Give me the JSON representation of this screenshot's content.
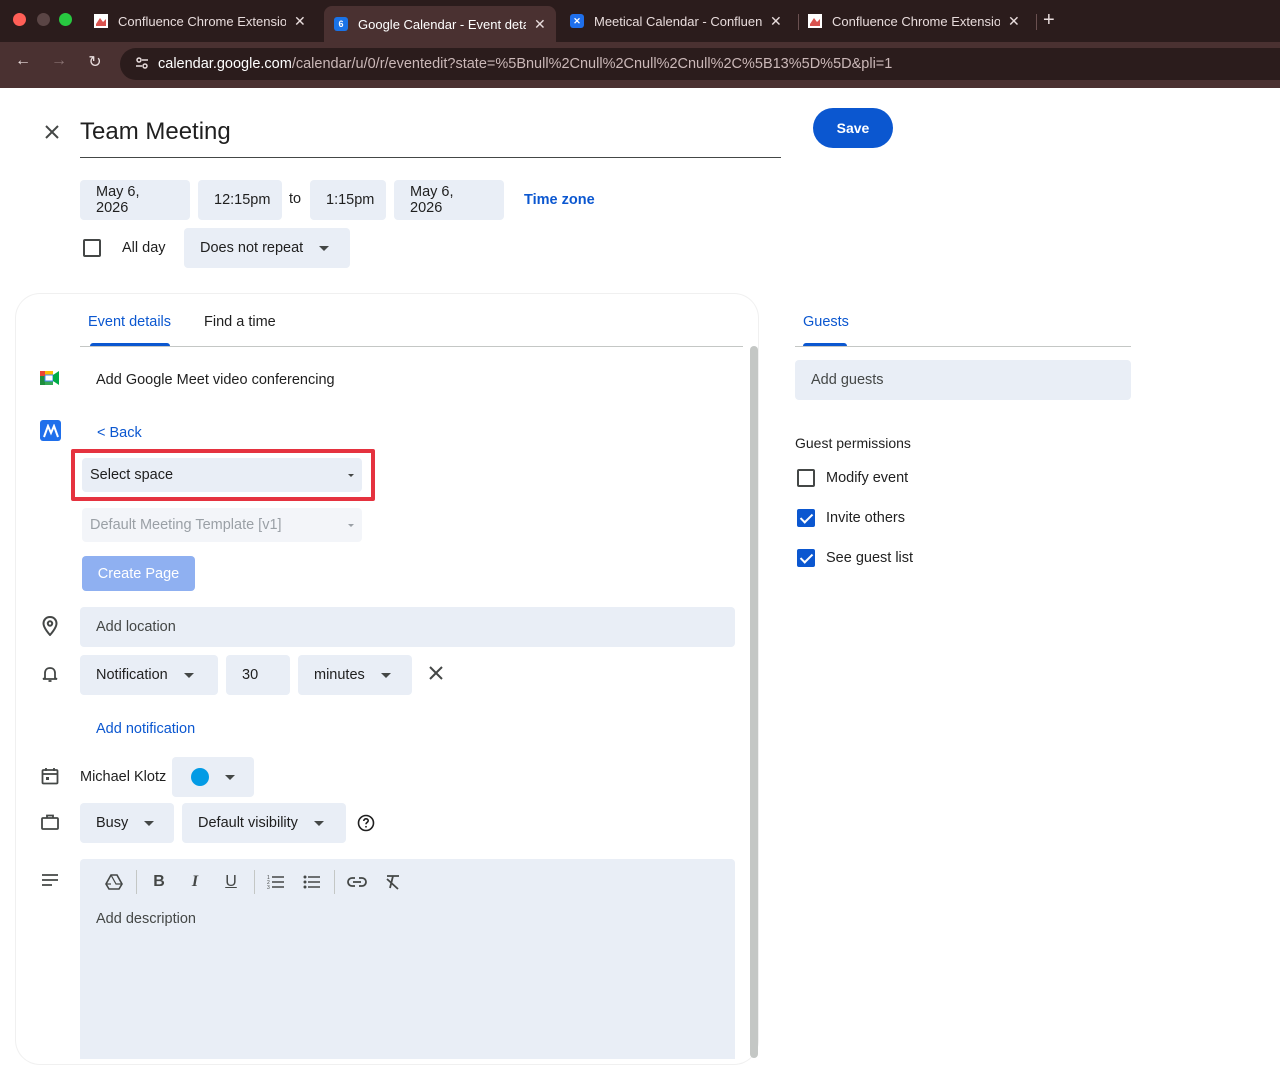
{
  "browser": {
    "tabs": [
      {
        "title": "Confluence Chrome Extension",
        "favicon_color": "#d9534f"
      },
      {
        "title": "Google Calendar - Event details",
        "favicon_color": "#1a73e8",
        "favicon_text": "6"
      },
      {
        "title": "Meetical Calendar - Confluence",
        "favicon_color": "#1f6feb"
      },
      {
        "title": "Confluence Chrome Extension",
        "favicon_color": "#d9534f"
      }
    ],
    "url_host": "calendar.google.com",
    "url_path": "/calendar/u/0/r/eventedit?state=%5Bnull%2Cnull%2Cnull%2Cnull%2C%5B13%5D%5D&pli=1"
  },
  "event": {
    "title": "Team Meeting",
    "save_label": "Save",
    "start_date": "May 6, 2026",
    "start_time": "12:15pm",
    "to_label": "to",
    "end_time": "1:15pm",
    "end_date": "May 6, 2026",
    "time_zone_label": "Time zone",
    "all_day_label": "All day",
    "repeat_value": "Does not repeat"
  },
  "details": {
    "tabs": [
      {
        "label": "Event details"
      },
      {
        "label": "Find a time"
      }
    ],
    "meet_label": "Add Google Meet video conferencing",
    "back_label": "< Back",
    "space_placeholder": "Select space",
    "template_value": "Default Meeting Template [v1]",
    "create_page_label": "Create Page",
    "location_placeholder": "Add location",
    "notification_type": "Notification",
    "notification_amount": "30",
    "notification_unit": "minutes",
    "add_notification_label": "Add notification",
    "calendar_owner": "Michael Klotz",
    "calendar_color": "#039be5",
    "busy_value": "Busy",
    "visibility_value": "Default visibility",
    "description_placeholder": "Add description"
  },
  "guests": {
    "tab_label": "Guests",
    "add_placeholder": "Add guests",
    "permissions_title": "Guest permissions",
    "permissions": [
      {
        "label": "Modify event",
        "checked": false
      },
      {
        "label": "Invite others",
        "checked": true
      },
      {
        "label": "See guest list",
        "checked": true
      }
    ]
  },
  "colors": {
    "accent": "#0b57d0",
    "highlight_frame": "#e5323f"
  }
}
